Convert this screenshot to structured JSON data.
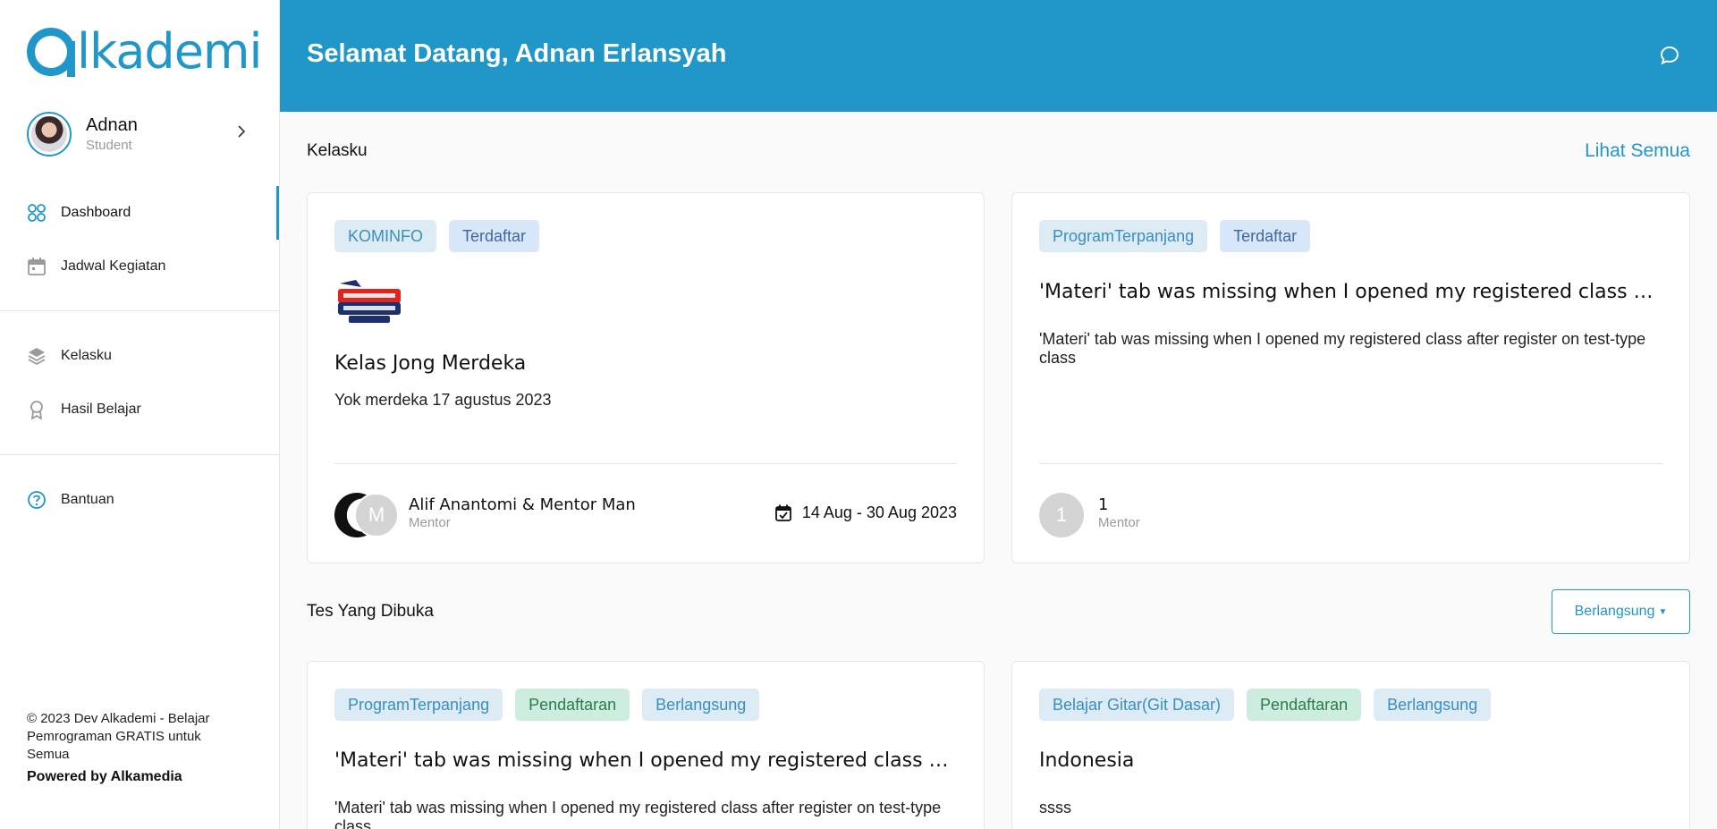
{
  "app": {
    "logo_text": "lkademi"
  },
  "user": {
    "name": "Adnan",
    "role": "Student"
  },
  "sidebar": {
    "items": [
      {
        "label": "Dashboard",
        "icon": "grid-icon"
      },
      {
        "label": "Jadwal Kegiatan",
        "icon": "calendar-icon"
      },
      {
        "label": "Kelasku",
        "icon": "layers-icon"
      },
      {
        "label": "Hasil Belajar",
        "icon": "award-icon"
      },
      {
        "label": "Bantuan",
        "icon": "help-icon"
      }
    ],
    "footer": "© 2023 Dev Alkademi - Belajar Pemrograman GRATIS untuk Semua",
    "powered": "Powered by Alkamedia"
  },
  "header": {
    "welcome": "Selamat Datang, Adnan Erlansyah"
  },
  "kelasku": {
    "title": "Kelasku",
    "view_all": "Lihat Semua",
    "cards": [
      {
        "tags": [
          "KOMINFO",
          "Terdaftar"
        ],
        "title": "Kelas Jong Merdeka",
        "desc": "Yok merdeka 17 agustus 2023",
        "avatar_letter": "M",
        "mentor": "Alif Anantomi & Mentor Man",
        "mentor_label": "Mentor",
        "date": "14 Aug - 30 Aug 2023"
      },
      {
        "tags": [
          "ProgramTerpanjang",
          "Terdaftar"
        ],
        "title": "'Materi' tab was missing when I opened my registered class after re...",
        "desc": "'Materi' tab was missing when I opened my registered class after register on test-type class",
        "avatar_letter": "1",
        "mentor": "1",
        "mentor_label": "Mentor"
      }
    ]
  },
  "tests": {
    "title": "Tes Yang Dibuka",
    "filter": "Berlangsung",
    "cards": [
      {
        "tags": [
          "ProgramTerpanjang",
          "Pendaftaran",
          "Berlangsung"
        ],
        "title": "'Materi' tab was missing when I opened my registered class after re...",
        "desc": "'Materi' tab was missing when I opened my registered class after register on test-type class"
      },
      {
        "tags": [
          "Belajar Gitar(Git Dasar)",
          "Pendaftaran",
          "Berlangsung"
        ],
        "title": "Indonesia",
        "desc": "ssss"
      }
    ]
  },
  "colors": {
    "primary": "#2196c9",
    "background": "#fafafa"
  }
}
